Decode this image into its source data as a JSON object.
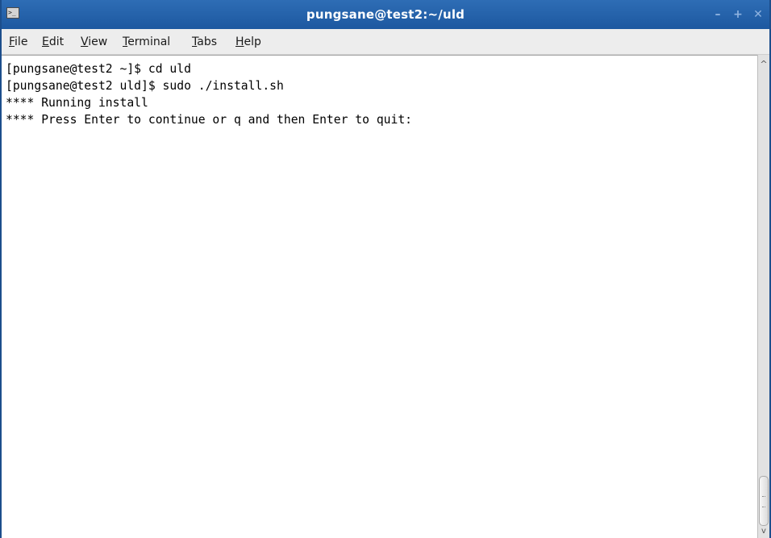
{
  "window": {
    "title": "pungsane@test2:~/uld",
    "app_icon": "terminal-icon",
    "controls": {
      "minimize": "–",
      "maximize": "+",
      "close": "✕"
    }
  },
  "menubar": {
    "items": [
      {
        "mnemonic": "F",
        "rest": "ile"
      },
      {
        "mnemonic": "E",
        "rest": "dit"
      },
      {
        "mnemonic": "V",
        "rest": "iew"
      },
      {
        "mnemonic": "T",
        "rest": "erminal"
      },
      {
        "mnemonic": "T",
        "rest": "abs"
      },
      {
        "mnemonic": "H",
        "rest": "elp"
      }
    ]
  },
  "terminal": {
    "lines": [
      "[pungsane@test2 ~]$ cd uld",
      "[pungsane@test2 uld]$ sudo ./install.sh",
      "**** Running install",
      "**** Press Enter to continue or q and then Enter to quit:"
    ]
  },
  "scrollbar": {
    "up_arrow": "^",
    "down_arrow": "v"
  },
  "colors": {
    "titlebar": "#1d58a0",
    "terminal_bg": "#ffffff",
    "terminal_fg": "#000000"
  }
}
